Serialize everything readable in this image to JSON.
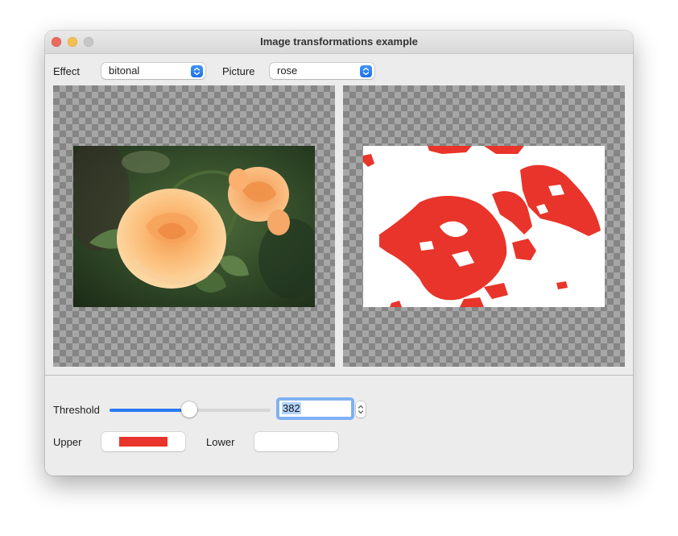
{
  "window": {
    "title": "Image transformations example"
  },
  "toolbar": {
    "effect_label": "Effect",
    "effect_value": "bitonal",
    "picture_label": "Picture",
    "picture_value": "rose"
  },
  "threshold": {
    "label": "Threshold",
    "value": "382",
    "slider_fraction": 0.5
  },
  "colors": {
    "upper_label": "Upper",
    "upper_color": "#e8342a",
    "lower_label": "Lower",
    "lower_color": "#ffffff"
  },
  "images": {
    "original": "rose photo",
    "transformed": "rose bitonal"
  }
}
